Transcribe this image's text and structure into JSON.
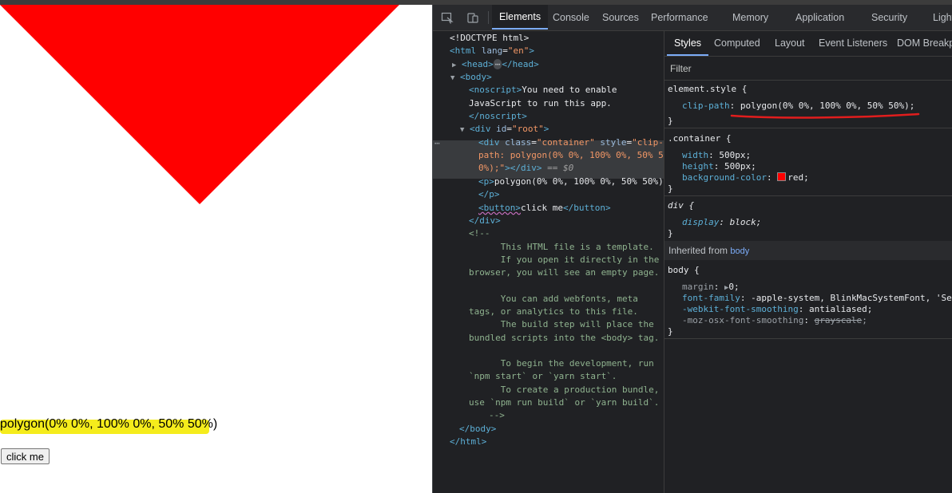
{
  "page": {
    "polygon_text": "polygon(0% 0%, 100% 0%, 50% 50%)",
    "button_label": "click me",
    "triangle_color": "#ff0000"
  },
  "devtools": {
    "tabs": [
      "Elements",
      "Console",
      "Sources",
      "Performance",
      "Memory",
      "Application",
      "Security",
      "Light"
    ],
    "active_tab": "Elements",
    "elements": {
      "doctype": "<!DOCTYPE html>",
      "html_open": "<html",
      "html_lang_attr": "lang",
      "html_lang_val": "\"en\"",
      "head_open": "<head>",
      "head_ellipsis": "⋯",
      "head_close": "</head>",
      "body_open": "<body>",
      "noscript_open": "<noscript>",
      "noscript_text1": "You need to enable",
      "noscript_text2": "JavaScript to run this app.",
      "noscript_close": "</noscript>",
      "div_root_open": "<div",
      "div_root_attr": "id",
      "div_root_val": "\"root\"",
      "div_root_end": ">",
      "container_open": "<div",
      "container_class_attr": "class",
      "container_class_val": "\"container\"",
      "container_style_attr": "style",
      "container_style_val1": "\"clip-",
      "container_style_val2": "path: polygon(0% 0%, 100% 0%, 50% 5",
      "container_style_val3": "0%);\"",
      "container_close": "></div>",
      "eq_dollar": "== $0",
      "ellipsis_marker": "⋯",
      "p_open": "<p>",
      "p_text": "polygon(0% 0%, 100% 0%, 50% 50%)",
      "p_close": "</p>",
      "button_open": "<button>",
      "button_text": "click me",
      "button_close": "</button>",
      "div_close": "</div>",
      "comment_open": "<!--",
      "comment_lines": [
        "      This HTML file is a template.",
        "      If you open it directly in the",
        "browser, you will see an empty page.",
        "",
        "      You can add webfonts, meta",
        "tags, or analytics to this file.",
        "      The build step will place the",
        "bundled scripts into the <body> tag.",
        "",
        "      To begin the development, run",
        "`npm start` or `yarn start`.",
        "      To create a production bundle,",
        "use `npm run build` or `yarn build`."
      ],
      "comment_close": "-->",
      "body_close": "</body>",
      "html_close": "</html>"
    },
    "styles": {
      "tabs": [
        "Styles",
        "Computed",
        "Layout",
        "Event Listeners",
        "DOM Breakpoints"
      ],
      "active_tab": "Styles",
      "filter_placeholder": "Filter",
      "element_style_selector": "element.style {",
      "clip_prop": "clip-path",
      "clip_val": "polygon(0% 0%, 100% 0%, 50% 50%);",
      "container_selector": ".container {",
      "width_prop": "width",
      "width_val": "500px;",
      "height_prop": "height",
      "height_val": "500px;",
      "bg_prop": "background-color",
      "bg_val": "red;",
      "div_selector": "div {",
      "display_prop": "display",
      "display_val": "block;",
      "close_brace": "}",
      "inherited_label": "Inherited from",
      "inherited_link": "body",
      "body_selector": "body {",
      "margin_prop": "margin",
      "margin_val": "0;",
      "font_family_prop": "font-family",
      "font_family_val": "-apple-system, BlinkMacSystemFont, 'Seg",
      "webkit_prop": "-webkit-font-smoothing",
      "webkit_val": "antialiased;",
      "moz_prop": "-moz-osx-font-smoothing",
      "moz_val": "grayscale",
      "annotation_color": "#e11d1d"
    }
  }
}
